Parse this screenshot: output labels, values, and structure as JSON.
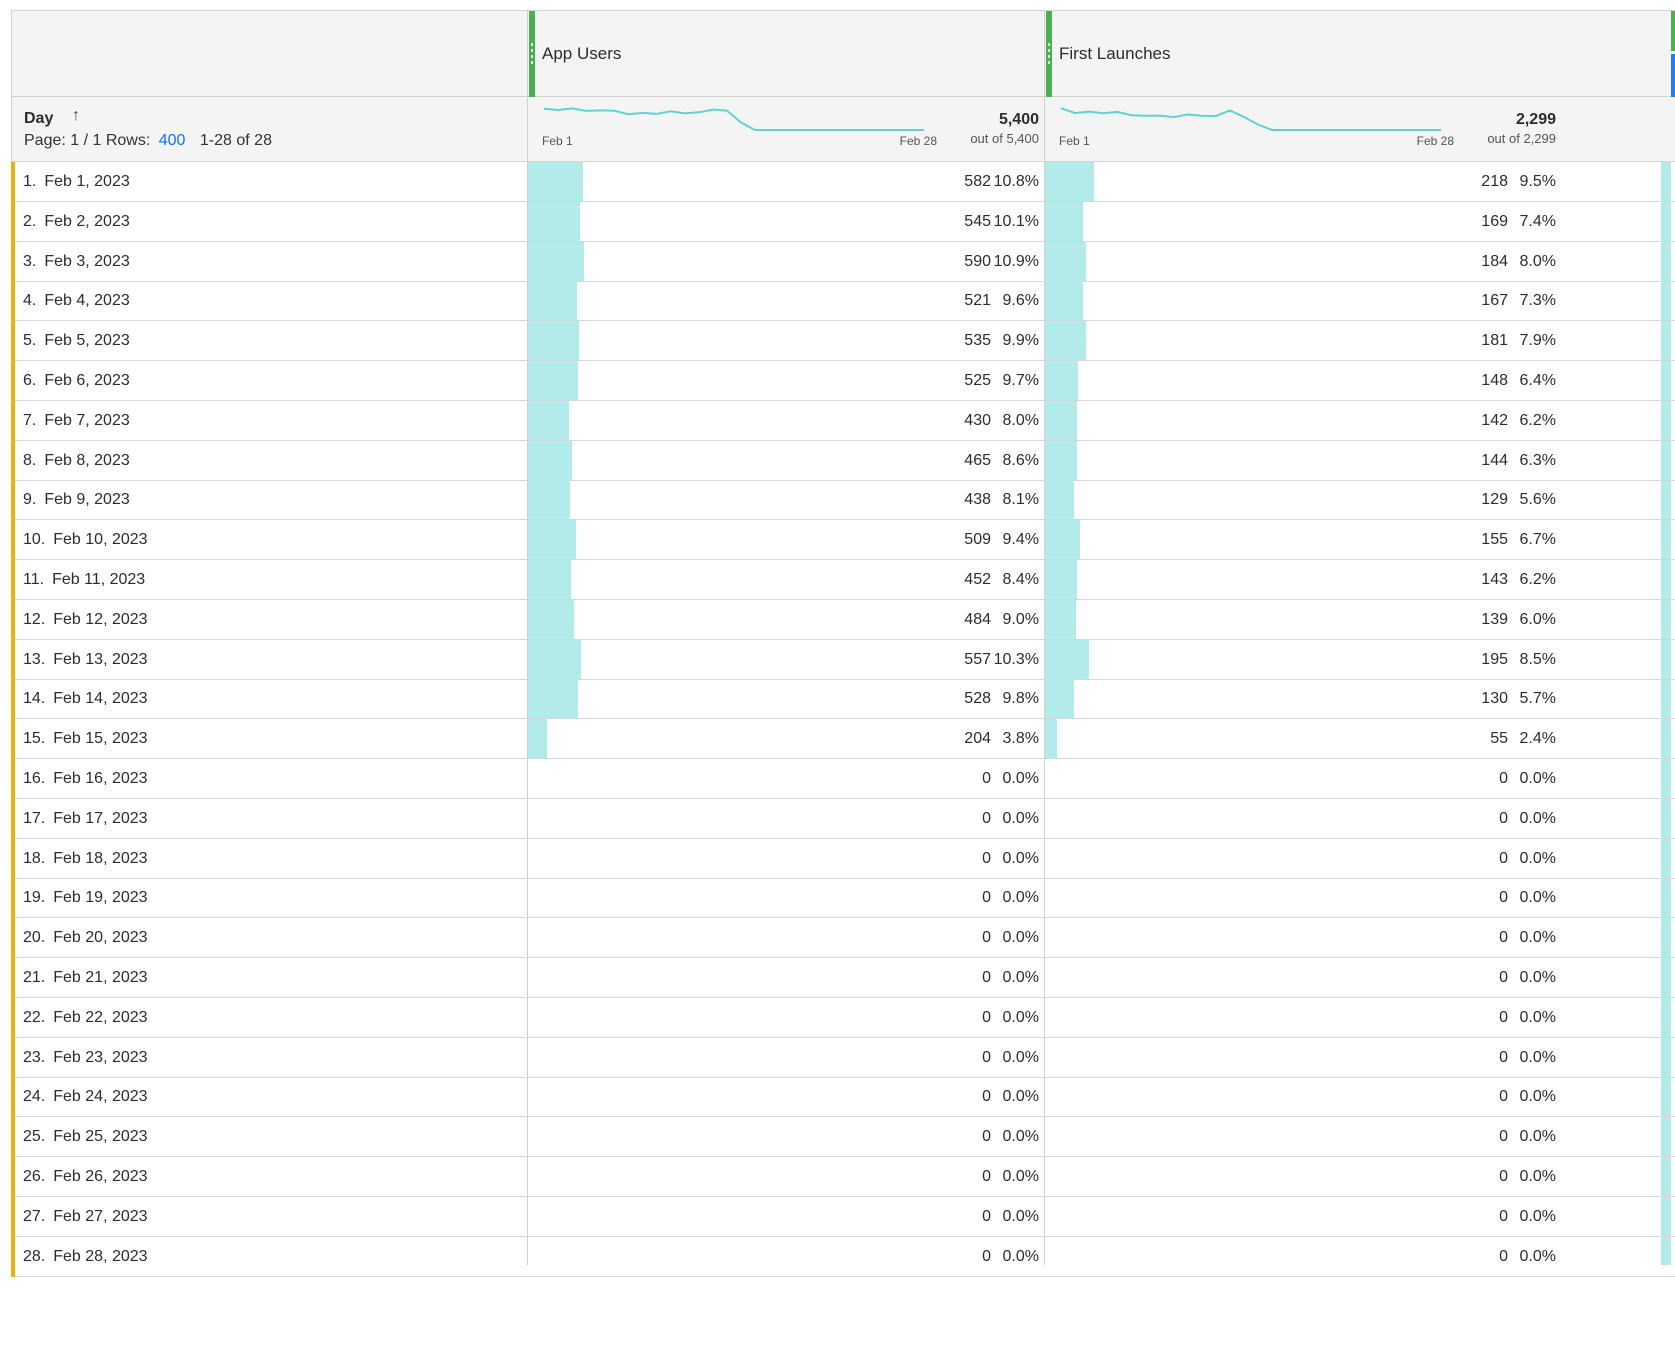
{
  "dimension": {
    "title": "Day",
    "page_label": "Page: 1 / 1",
    "rows_label": "Rows:",
    "rows_value": "400",
    "range_label": "1-28 of 28"
  },
  "metrics": [
    {
      "title": "App Users",
      "total": "5,400",
      "out_of": "out of 5,400",
      "spark_start": "Feb 1",
      "spark_end": "Feb 28"
    },
    {
      "title": "First Launches",
      "total": "2,299",
      "out_of": "out of 2,299",
      "spark_start": "Feb 1",
      "spark_end": "Feb 28"
    }
  ],
  "rows": [
    {
      "idx": "1.",
      "day": "Feb 1, 2023",
      "m1": "582",
      "p1": "10.8%",
      "m2": "218",
      "p2": "9.5%"
    },
    {
      "idx": "2.",
      "day": "Feb 2, 2023",
      "m1": "545",
      "p1": "10.1%",
      "m2": "169",
      "p2": "7.4%"
    },
    {
      "idx": "3.",
      "day": "Feb 3, 2023",
      "m1": "590",
      "p1": "10.9%",
      "m2": "184",
      "p2": "8.0%"
    },
    {
      "idx": "4.",
      "day": "Feb 4, 2023",
      "m1": "521",
      "p1": "9.6%",
      "m2": "167",
      "p2": "7.3%"
    },
    {
      "idx": "5.",
      "day": "Feb 5, 2023",
      "m1": "535",
      "p1": "9.9%",
      "m2": "181",
      "p2": "7.9%"
    },
    {
      "idx": "6.",
      "day": "Feb 6, 2023",
      "m1": "525",
      "p1": "9.7%",
      "m2": "148",
      "p2": "6.4%"
    },
    {
      "idx": "7.",
      "day": "Feb 7, 2023",
      "m1": "430",
      "p1": "8.0%",
      "m2": "142",
      "p2": "6.2%"
    },
    {
      "idx": "8.",
      "day": "Feb 8, 2023",
      "m1": "465",
      "p1": "8.6%",
      "m2": "144",
      "p2": "6.3%"
    },
    {
      "idx": "9.",
      "day": "Feb 9, 2023",
      "m1": "438",
      "p1": "8.1%",
      "m2": "129",
      "p2": "5.6%"
    },
    {
      "idx": "10.",
      "day": "Feb 10, 2023",
      "m1": "509",
      "p1": "9.4%",
      "m2": "155",
      "p2": "6.7%"
    },
    {
      "idx": "11.",
      "day": "Feb 11, 2023",
      "m1": "452",
      "p1": "8.4%",
      "m2": "143",
      "p2": "6.2%"
    },
    {
      "idx": "12.",
      "day": "Feb 12, 2023",
      "m1": "484",
      "p1": "9.0%",
      "m2": "139",
      "p2": "6.0%"
    },
    {
      "idx": "13.",
      "day": "Feb 13, 2023",
      "m1": "557",
      "p1": "10.3%",
      "m2": "195",
      "p2": "8.5%"
    },
    {
      "idx": "14.",
      "day": "Feb 14, 2023",
      "m1": "528",
      "p1": "9.8%",
      "m2": "130",
      "p2": "5.7%"
    },
    {
      "idx": "15.",
      "day": "Feb 15, 2023",
      "m1": "204",
      "p1": "3.8%",
      "m2": "55",
      "p2": "2.4%"
    },
    {
      "idx": "16.",
      "day": "Feb 16, 2023",
      "m1": "0",
      "p1": "0.0%",
      "m2": "0",
      "p2": "0.0%"
    },
    {
      "idx": "17.",
      "day": "Feb 17, 2023",
      "m1": "0",
      "p1": "0.0%",
      "m2": "0",
      "p2": "0.0%"
    },
    {
      "idx": "18.",
      "day": "Feb 18, 2023",
      "m1": "0",
      "p1": "0.0%",
      "m2": "0",
      "p2": "0.0%"
    },
    {
      "idx": "19.",
      "day": "Feb 19, 2023",
      "m1": "0",
      "p1": "0.0%",
      "m2": "0",
      "p2": "0.0%"
    },
    {
      "idx": "20.",
      "day": "Feb 20, 2023",
      "m1": "0",
      "p1": "0.0%",
      "m2": "0",
      "p2": "0.0%"
    },
    {
      "idx": "21.",
      "day": "Feb 21, 2023",
      "m1": "0",
      "p1": "0.0%",
      "m2": "0",
      "p2": "0.0%"
    },
    {
      "idx": "22.",
      "day": "Feb 22, 2023",
      "m1": "0",
      "p1": "0.0%",
      "m2": "0",
      "p2": "0.0%"
    },
    {
      "idx": "23.",
      "day": "Feb 23, 2023",
      "m1": "0",
      "p1": "0.0%",
      "m2": "0",
      "p2": "0.0%"
    },
    {
      "idx": "24.",
      "day": "Feb 24, 2023",
      "m1": "0",
      "p1": "0.0%",
      "m2": "0",
      "p2": "0.0%"
    },
    {
      "idx": "25.",
      "day": "Feb 25, 2023",
      "m1": "0",
      "p1": "0.0%",
      "m2": "0",
      "p2": "0.0%"
    },
    {
      "idx": "26.",
      "day": "Feb 26, 2023",
      "m1": "0",
      "p1": "0.0%",
      "m2": "0",
      "p2": "0.0%"
    },
    {
      "idx": "27.",
      "day": "Feb 27, 2023",
      "m1": "0",
      "p1": "0.0%",
      "m2": "0",
      "p2": "0.0%"
    },
    {
      "idx": "28.",
      "day": "Feb 28, 2023",
      "m1": "0",
      "p1": "0.0%",
      "m2": "0",
      "p2": "0.0%"
    }
  ],
  "colors": {
    "bar": "#b2ebe9",
    "sparkline": "#5fd3d3",
    "row_accent": "#e8b30f",
    "metric_grip": "#4caf50",
    "link": "#1473e6"
  }
}
